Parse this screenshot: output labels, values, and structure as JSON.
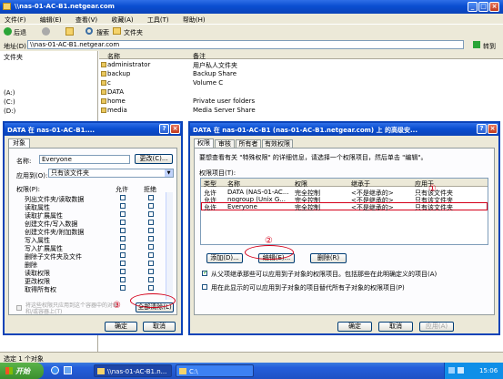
{
  "explorer": {
    "title": "\\\\nas-01-AC-B1.netgear.com",
    "menu": [
      "文件(F)",
      "编辑(E)",
      "查看(V)",
      "收藏(A)",
      "工具(T)",
      "帮助(H)"
    ],
    "toolbar": {
      "back": "后退",
      "search": "搜索",
      "folders": "文件夹"
    },
    "address_label": "地址(D)",
    "address_value": "\\\\nas-01-AC-B1.netgear.com",
    "go": "转到",
    "left_header": "文件夹",
    "col_name": "名称",
    "col_desc": "备注",
    "drives": [
      "(A:)",
      "(C:)",
      "(D:)"
    ],
    "files": [
      {
        "name": "administrator",
        "desc": "用户私人文件夹"
      },
      {
        "name": "backup",
        "desc": "Backup Share"
      },
      {
        "name": "c",
        "desc": "Volume C"
      },
      {
        "name": "DATA",
        "desc": ""
      },
      {
        "name": "home",
        "desc": "Private user folders"
      },
      {
        "name": "media",
        "desc": "Media Server Share"
      }
    ],
    "status": "选定 1 个对象"
  },
  "dlg_left": {
    "title": "DATA 在 nas-01-AC-B1....",
    "tab": "对象",
    "name_label": "名称:",
    "name_value": "Everyone",
    "change_btn": "更改(C)...",
    "apply_label": "应用到(O):",
    "apply_value": "只有该文件夹",
    "perm_header": "权限(P):",
    "allow": "允许",
    "deny": "拒绝",
    "perms": [
      "列出文件夹/读取数据",
      "读取属性",
      "读取扩展属性",
      "创建文件/写入数据",
      "创建文件夹/附加数据",
      "写入属性",
      "写入扩展属性",
      "删除子文件夹及文件",
      "删除",
      "读取权限",
      "更改权限",
      "取得所有权"
    ],
    "note": "将这些权限只应用到这个容器中的对象和/或容器上(T)",
    "clear_btn": "全部清除(L)",
    "ok": "确定",
    "cancel": "取消"
  },
  "dlg_right": {
    "title": "DATA 在 nas-01-AC-B1 (nas-01-AC-B1.netgear.com) 上 的高级安...",
    "tabs": [
      "权限",
      "审核",
      "所有者",
      "有效权限"
    ],
    "desc": "要想查看有关 \"特殊权限\" 的详细信息，请选择一个权限项目，然后单击 \"编辑\"。",
    "items_label": "权限项目(T):",
    "cols": [
      "类型",
      "名称",
      "权限",
      "继承于",
      "应用于"
    ],
    "rows": [
      [
        "允许",
        "DATA (NAS-01-AC...",
        "完全控制",
        "<不是继承的>",
        "只有该文件夹"
      ],
      [
        "允许",
        "nogroup (Unix G...",
        "完全控制",
        "<不是继承的>",
        "只有该文件夹"
      ],
      [
        "允许",
        "Everyone",
        "完全控制",
        "<不是继承的>",
        "只有该文件夹"
      ]
    ],
    "add": "添加(D)...",
    "edit": "编辑(E)...",
    "remove": "删除(R)",
    "chk1": "从父项继承那些可以应用到子对象的权限项目。包括那些在此明确定义的项目(A)",
    "chk2": "用在此显示的可以应用到子对象的项目替代所有子对象的权限项目(P)",
    "ok": "确定",
    "cancel": "取消",
    "apply": "应用(A)"
  },
  "markers": [
    "①",
    "②",
    "③"
  ],
  "taskbar": {
    "start": "开始",
    "task1": "\\\\nas-01-AC-B1.n...",
    "task2": "C:\\",
    "time": "15:06"
  }
}
